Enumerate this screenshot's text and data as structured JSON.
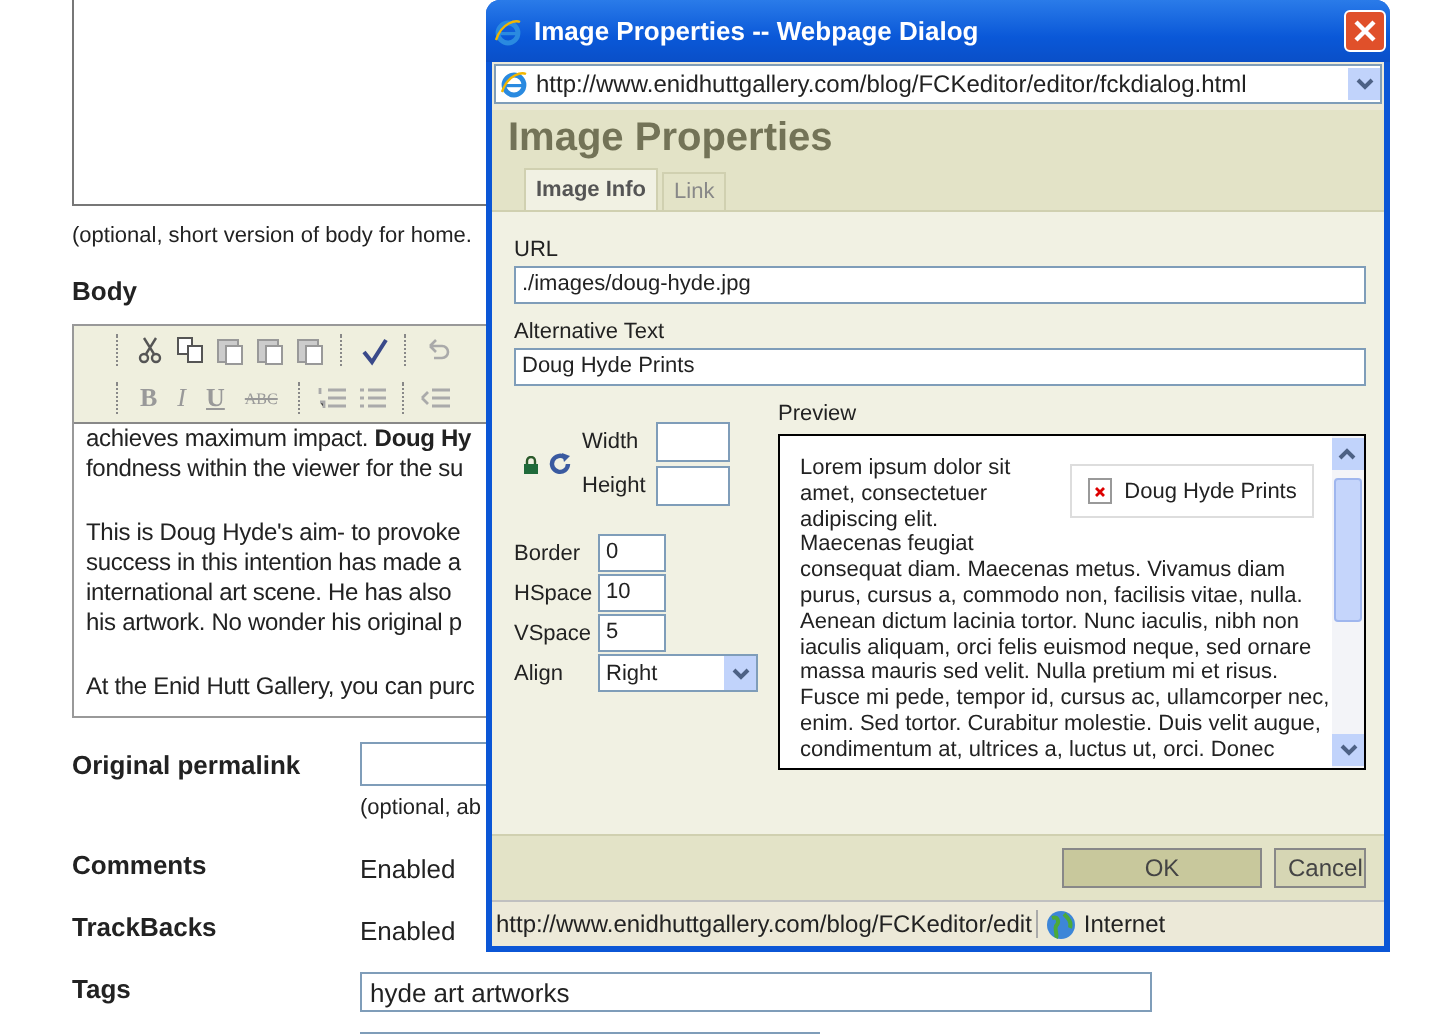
{
  "page": {
    "excerpt_hint": "(optional, short version of body for home.",
    "body_label": "Body",
    "toolbar_text_buttons": [
      {
        "label": "B",
        "kind": "bold"
      },
      {
        "label": "I",
        "kind": "italic"
      },
      {
        "label": "U",
        "kind": "underline"
      },
      {
        "label": "ABC",
        "kind": "strike"
      }
    ],
    "editor_paragraphs": [
      "achieves maximum impact. **Doug Hy**\nfondness within the viewer for the su",
      "This is Doug Hyde's aim- to provoke\nsuccess in this intention has made a\ninternational art scene. He has also\nhis artwork. No wonder his original p",
      "At the Enid Hutt Gallery, you can purc"
    ],
    "permalink": {
      "label": "Original permalink",
      "hint": "(optional, ab"
    },
    "settings": [
      {
        "label": "Comments",
        "value": "Enabled"
      },
      {
        "label": "TrackBacks",
        "value": "Enabled"
      }
    ],
    "tags": {
      "label": "Tags",
      "value": "hyde art artworks"
    }
  },
  "dialog": {
    "title": "Image Properties -- Webpage Dialog",
    "address": "http://www.enidhuttgallery.com/blog/FCKeditor/editor/fckdialog.html",
    "heading": "Image Properties",
    "tabs": [
      {
        "label": "Image Info",
        "selected": true
      },
      {
        "label": "Link",
        "selected": false
      }
    ],
    "url": {
      "label": "URL",
      "value": "./images/doug-hyde.jpg"
    },
    "alt": {
      "label": "Alternative Text",
      "value": "Doug Hyde Prints"
    },
    "size_fields": [
      {
        "label": "Width"
      },
      {
        "label": "Height"
      }
    ],
    "spacing_fields": [
      {
        "label": "Border",
        "value": "0"
      },
      {
        "label": "HSpace",
        "value": "10"
      },
      {
        "label": "VSpace",
        "value": "5"
      }
    ],
    "align": {
      "label": "Align",
      "value": "Right"
    },
    "preview": {
      "label": "Preview",
      "image_alt": "Doug Hyde Prints",
      "lead": "Lorem ipsum dolor sit\namet, consectetuer\nadipiscing elit.\nMaecenas feugiat",
      "body": "consequat diam. Maecenas metus. Vivamus diam\npurus, cursus a, commodo non, facilisis vitae, nulla.\nAenean dictum lacinia tortor. Nunc iaculis, nibh non\niaculis aliquam, orci felis euismod neque, sed ornare\nmassa mauris sed velit. Nulla pretium mi et risus.\nFusce mi pede, tempor id, cursus ac, ullamcorper nec,\nenim. Sed tortor. Curabitur molestie. Duis velit augue,\ncondimentum at, ultrices a, luctus ut, orci. Donec"
    },
    "buttons": [
      {
        "label": "OK",
        "kind": "primary"
      },
      {
        "label": "Cancel",
        "kind": "secondary"
      }
    ],
    "status": {
      "url": "http://www.enidhuttgallery.com/blog/FCKeditor/edit",
      "zone": "Internet"
    }
  }
}
